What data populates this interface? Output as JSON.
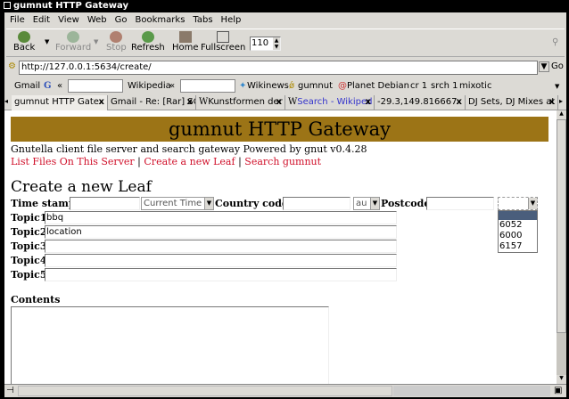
{
  "window": {
    "title": "gumnut HTTP Gateway"
  },
  "menu": [
    "File",
    "Edit",
    "View",
    "Web",
    "Go",
    "Bookmarks",
    "Tabs",
    "Help"
  ],
  "toolbar": {
    "back": "Back",
    "forward": "Forward",
    "stop": "Stop",
    "refresh": "Refresh",
    "home": "Home",
    "fullscreen": "Fullscreen",
    "zoom": "110"
  },
  "address": {
    "url": "http://127.0.0.1:5634/create/",
    "go": "Go"
  },
  "bookmarks": {
    "gmail": "Gmail",
    "wikipedia": "Wikipedia",
    "items": [
      "Wikinews",
      "gumnut",
      "Planet Debian",
      "cr 1",
      "srch 1",
      "mixotic"
    ]
  },
  "tabs": [
    "gumnut HTTP Gate",
    "Gmail - Re: [Rar] SC",
    "Kunstformen der",
    "Search - Wikiped",
    "-29.3,149.816667",
    "DJ Sets, DJ Mixes at"
  ],
  "page": {
    "banner": "gumnut HTTP Gateway",
    "subtitle": "Gnutella client file server and search gateway Powered by gnut v0.4.28",
    "links": [
      "List Files On This Server",
      "Create a new Leaf",
      "Search gumnut"
    ],
    "sep": "|",
    "heading": "Create a new Leaf",
    "timestamp_label": "Time stamp",
    "timestamp_select": "Current Time",
    "country_label": "Country code",
    "country_select": "au",
    "postcode_label": "Postcode",
    "postcode_options": [
      "",
      "6052",
      "6000",
      "6157"
    ],
    "topics": [
      {
        "label": "Topic1",
        "value": "bbq"
      },
      {
        "label": "Topic2",
        "value": "location"
      },
      {
        "label": "Topic3",
        "value": ""
      },
      {
        "label": "Topic4",
        "value": ""
      },
      {
        "label": "Topic5",
        "value": ""
      }
    ],
    "contents_label": "Contents"
  }
}
